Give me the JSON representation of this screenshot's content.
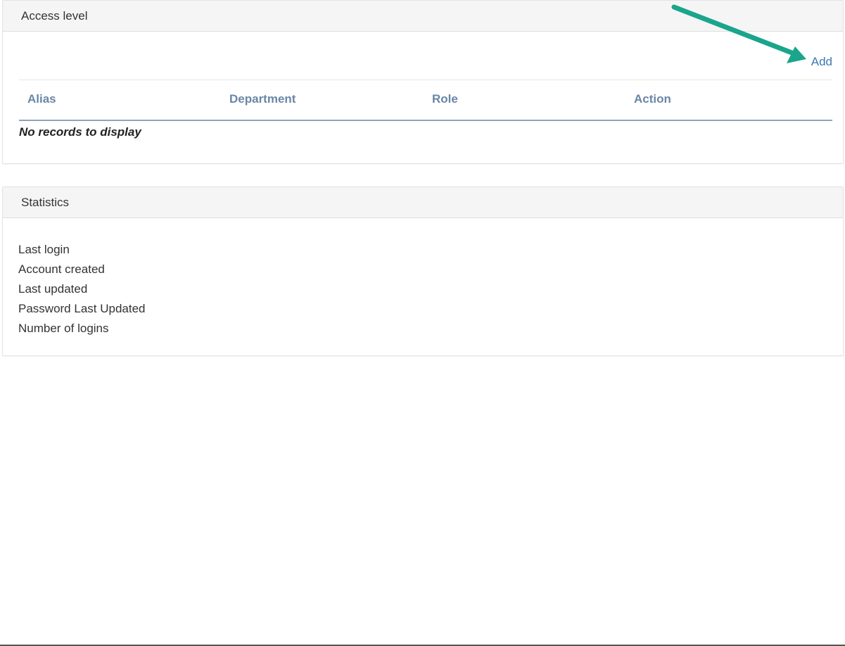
{
  "access_level": {
    "title": "Access level",
    "add_label": "Add",
    "columns": [
      "Alias",
      "Department",
      "Role",
      "Action"
    ],
    "empty_text": "No records to display"
  },
  "statistics": {
    "title": "Statistics",
    "items": [
      "Last login",
      "Account created",
      "Last updated",
      "Password Last Updated",
      "Number of logins"
    ]
  },
  "colors": {
    "link": "#3d78b5",
    "column_header": "#6a86a6",
    "annotation_arrow": "#1aa58c"
  }
}
